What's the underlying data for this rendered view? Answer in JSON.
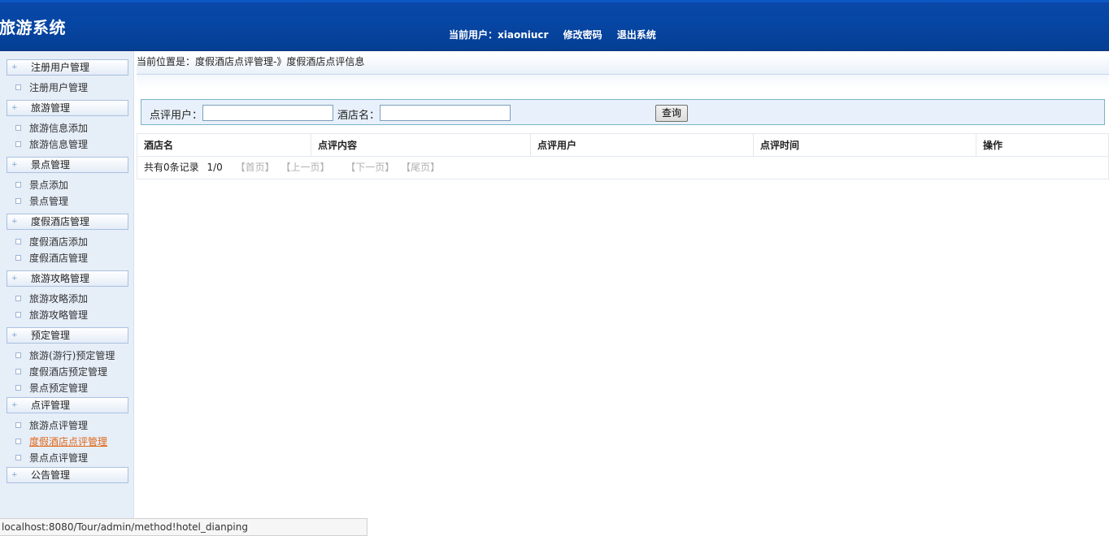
{
  "header": {
    "title": "旅游系统",
    "current_user_label": "当前用户：xiaoniucr",
    "change_password": "修改密码",
    "logout": "退出系统"
  },
  "sidebar": {
    "groups": [
      {
        "label": "注册用户管理",
        "items": [
          "注册用户管理"
        ]
      },
      {
        "label": "旅游管理",
        "items": [
          "旅游信息添加",
          "旅游信息管理"
        ]
      },
      {
        "label": "景点管理",
        "items": [
          "景点添加",
          "景点管理"
        ]
      },
      {
        "label": "度假酒店管理",
        "items": [
          "度假酒店添加",
          "度假酒店管理"
        ]
      },
      {
        "label": "旅游攻略管理",
        "items": [
          "旅游攻略添加",
          "旅游攻略管理"
        ]
      },
      {
        "label": "预定管理",
        "items": [
          "旅游(游行)预定管理",
          "度假酒店预定管理",
          "景点预定管理"
        ]
      },
      {
        "label": "点评管理",
        "items": [
          "旅游点评管理",
          "度假酒店点评管理",
          "景点点评管理"
        ]
      },
      {
        "label": "公告管理",
        "items": []
      }
    ],
    "active_item": "度假酒店点评管理"
  },
  "breadcrumb": "当前位置是：度假酒店点评管理-》度假酒店点评信息",
  "search": {
    "user_label": "点评用户：",
    "user_value": "",
    "hotel_label": "酒店名：",
    "hotel_value": "",
    "button": "查询"
  },
  "table": {
    "columns": [
      "酒店名",
      "点评内容",
      "点评用户",
      "点评时间",
      "操作"
    ],
    "rows": []
  },
  "pagination": {
    "total": "共有0条记录",
    "page": "1/0",
    "first": "【首页】",
    "prev": "【上一页】",
    "next": "【下一页】",
    "last": "【尾页】"
  },
  "status_bar": "localhost:8080/Tour/admin/method!hotel_dianping",
  "colors": {
    "header_blue": "#0646a3",
    "sidebar_bg": "#e6eef8",
    "active_link": "#e0681a",
    "disabled_pager": "#b0b0b0"
  }
}
